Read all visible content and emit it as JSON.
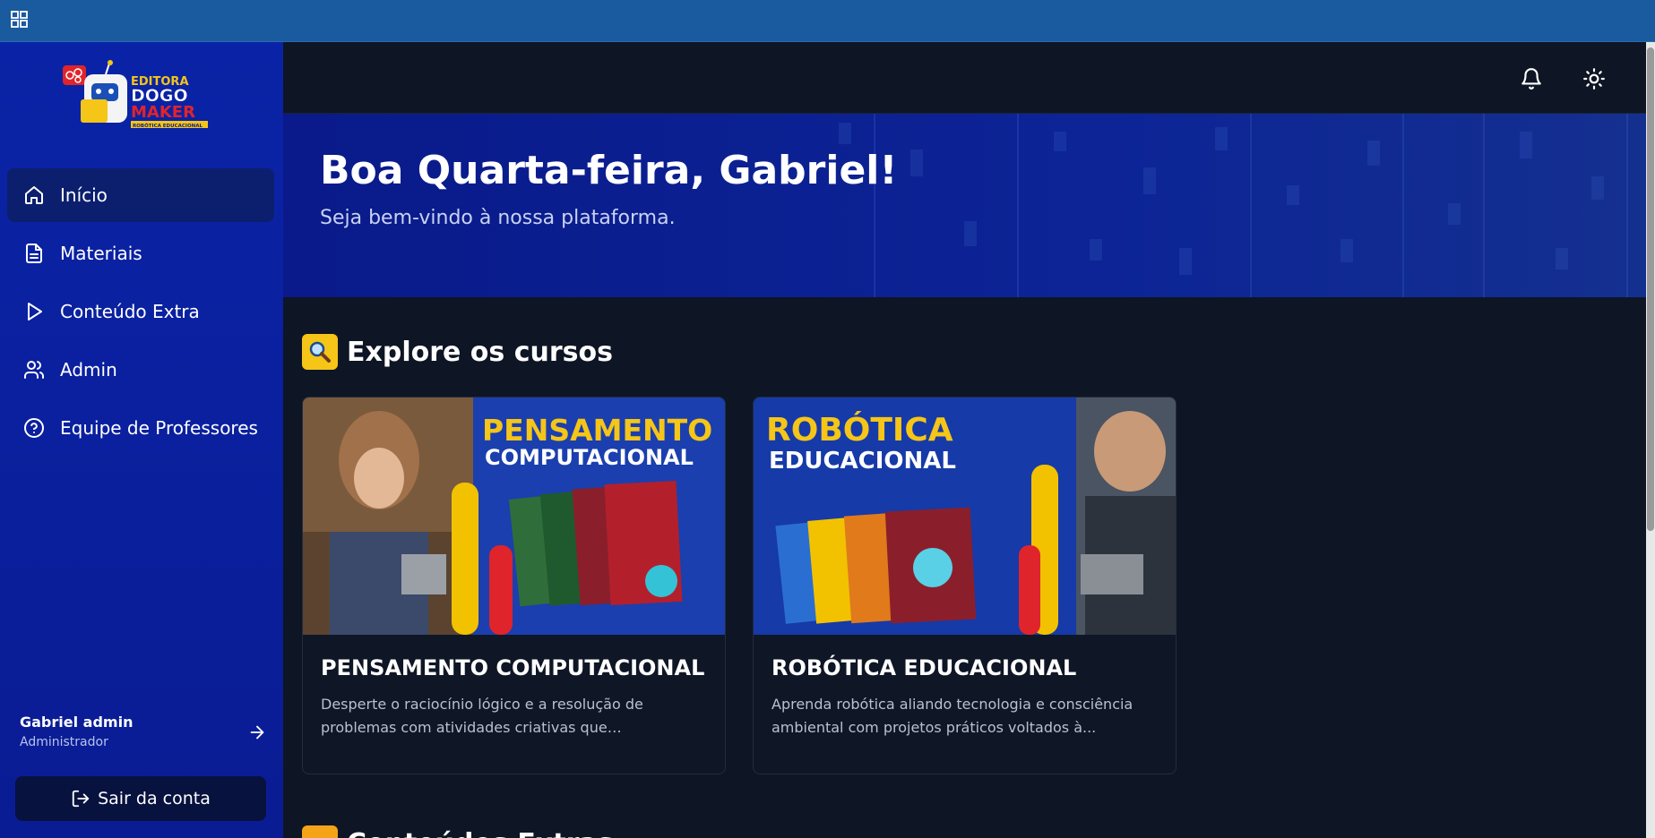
{
  "topbar": {
    "apps_icon": "grid-icon"
  },
  "sidebar": {
    "logo": {
      "line1": "EDITORA",
      "line2": "DOGO",
      "line3": "MAKER",
      "tagline": "ROBÓTICA EDUCACIONAL"
    },
    "items": [
      {
        "label": "Início",
        "icon": "home-icon",
        "active": true
      },
      {
        "label": "Materiais",
        "icon": "document-icon",
        "active": false
      },
      {
        "label": "Conteúdo Extra",
        "icon": "play-icon",
        "active": false
      },
      {
        "label": "Admin",
        "icon": "users-icon",
        "active": false
      },
      {
        "label": "Equipe de Professores",
        "icon": "help-circle-icon",
        "active": false
      }
    ],
    "user": {
      "name": "Gabriel admin",
      "role": "Administrador"
    },
    "logout_label": "Sair da conta"
  },
  "header": {
    "icons": [
      "bell-icon",
      "sun-icon"
    ]
  },
  "hero": {
    "title": "Boa Quarta-feira, Gabriel!",
    "subtitle": "Seja bem-vindo à nossa plataforma."
  },
  "explore": {
    "emoji": "🔍",
    "title": "Explore os cursos",
    "courses": [
      {
        "title": "PENSAMENTO COMPUTACIONAL",
        "description": "Desperte o raciocínio lógico e a resolução de problemas com atividades criativas que desenvolve...",
        "banner_line1": "PENSAMENTO",
        "banner_line2": "COMPUTACIONAL"
      },
      {
        "title": "ROBÓTICA EDUCACIONAL",
        "description": "Aprenda robótica aliando tecnologia e consciência ambiental com projetos práticos voltados à...",
        "banner_line1": "ROBÓTICA",
        "banner_line2": "EDUCACIONAL"
      }
    ]
  },
  "next_section": {
    "title": "Conteúdos Extras"
  },
  "colors": {
    "topbar": "#1a5a9e",
    "sidebar": "#0a23a6",
    "background": "#0e1524",
    "accent_yellow": "#f5c518",
    "hero": "#0b1f8f"
  }
}
